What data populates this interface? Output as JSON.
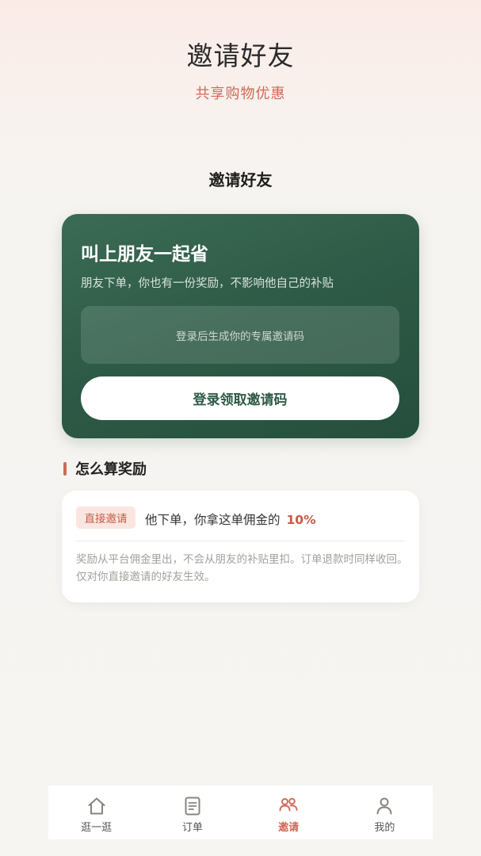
{
  "header": {
    "title": "邀请好友",
    "subtitle": "共享购物优惠"
  },
  "section": {
    "title": "邀请好友"
  },
  "invite_card": {
    "heading": "叫上朋友一起省",
    "description": "朋友下单，你也有一份奖励，不影响他自己的补贴",
    "code_placeholder": "登录后生成你的专属邀请码",
    "login_button": "登录领取邀请码"
  },
  "rewards": {
    "heading": "怎么算奖励",
    "tag": "直接邀请",
    "line": "他下单，你拿这单佣金的",
    "percent": "10%",
    "note": "奖励从平台佣金里出，不会从朋友的补贴里扣。订单退款时同样收回。仅对你直接邀请的好友生效。"
  },
  "tabbar": {
    "items": [
      {
        "label": "逛一逛",
        "icon": "home-icon",
        "active": false
      },
      {
        "label": "订单",
        "icon": "order-list-icon",
        "active": false
      },
      {
        "label": "邀请",
        "icon": "invite-people-icon",
        "active": true
      },
      {
        "label": "我的",
        "icon": "user-icon",
        "active": false
      }
    ]
  },
  "colors": {
    "accent": "#d06a55",
    "card_green": "#2d5a46",
    "tab_inactive": "#8a8480"
  }
}
